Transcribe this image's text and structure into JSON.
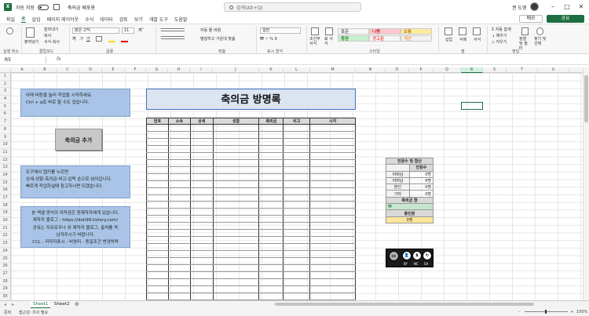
{
  "titlebar": {
    "autosave_label": "자동 저장",
    "autosave_state": "끔",
    "document_title": "축의금 배포용",
    "search_placeholder": "검색(Alt+Q)",
    "user_name": "권 도영"
  },
  "menu": {
    "tabs": [
      "파일",
      "홈",
      "삽입",
      "페이지 레이아웃",
      "수식",
      "데이터",
      "검토",
      "보기",
      "개발 도구",
      "도움말"
    ],
    "active_tab": "홈",
    "comment_label": "메모",
    "share_label": "공유"
  },
  "ribbon": {
    "groups": [
      "실행 취소",
      "클립보드",
      "글꼴",
      "맞춤",
      "표시 형식",
      "스타일",
      "셀",
      "편집"
    ],
    "paste_label": "붙여넣기",
    "cut_label": "잘라내기",
    "copy_label": "복사",
    "format_painter_label": "서식 복사",
    "font_name": "맑은 고딕",
    "font_size": "11",
    "wrap_text_label": "자동 줄 바꿈",
    "merge_label": "병합하고 가운데 맞춤",
    "number_format": "일반",
    "cond_format_label": "조건부 서식",
    "table_format_label": "표 서식",
    "styles": [
      {
        "name": "표준",
        "bg": "#ffffff",
        "color": "#222222"
      },
      {
        "name": "나쁨",
        "bg": "#ffc7ce",
        "color": "#9c0006"
      },
      {
        "name": "보통",
        "bg": "#ffeb9c",
        "color": "#9c5700"
      },
      {
        "name": "좋음",
        "bg": "#c6efce",
        "color": "#006100"
      },
      {
        "name": "경고문",
        "bg": "#ffffff",
        "color": "#ff0000"
      },
      {
        "name": "계산",
        "bg": "#f2f2f2",
        "color": "#fa7d00"
      }
    ],
    "insert_label": "삽입",
    "delete_label": "삭제",
    "format_label": "서식",
    "autosum_label": "자동 합계",
    "fill_label": "채우기",
    "clear_label": "지우기",
    "sort_label": "정렬 및 필터",
    "find_label": "찾기 및 선택"
  },
  "formula": {
    "name_box": "R5",
    "fx": "fx"
  },
  "columns": [
    "A",
    "B",
    "C",
    "D",
    "E",
    "F",
    "G",
    "H",
    "I",
    "J",
    "K",
    "L",
    "M",
    "N",
    "O",
    "P",
    "Q",
    "R",
    "S",
    "T",
    "U"
  ],
  "selected_column": "R",
  "rows": [
    "1",
    "2",
    "3",
    "4",
    "5",
    "6",
    "7",
    "8",
    "9",
    "10",
    "11",
    "12",
    "13",
    "14",
    "15",
    "16",
    "17",
    "18",
    "19",
    "20",
    "21",
    "22",
    "23",
    "24",
    "25",
    "26",
    "27",
    "28",
    "29",
    "30"
  ],
  "sheet": {
    "callout1": [
      "아래 버튼을 눌러 작업을 시작하세요.",
      "Ctrl + q로 바로 할 수도 있습니다."
    ],
    "add_button": "축의금 추가",
    "callout2": [
      "도구에서 탭키를 누르면",
      "상세-성함-축의금-비고-입력 순으로 넘어갑니다.",
      "빠르게 작업하실때 참고하시면 되겠습니다."
    ],
    "callout3": [
      "본 엑셀 양식의 저작권은 원제작자에게 있습니다.",
      "제작자 블로그 : https://doh99.tistory.com/",
      "공유는 자유로우나 위 제작자 블로그, 출처를 꼭",
      "남겨주시기 바랍니다.",
      "CCL : 저작자표시 - 비영리 - 동일조건 변경허락"
    ],
    "banner_title": "축의금 방명록",
    "table_headers": [
      "번호",
      "소속",
      "상세",
      "성함",
      "축의금",
      "비고",
      "시각"
    ],
    "summary": {
      "title": "인원수 및 합산",
      "count_header": "인원수",
      "rows": [
        {
          "label": "아버님",
          "value": "0명"
        },
        {
          "label": "어머님",
          "value": "0명"
        },
        {
          "label": "본인",
          "value": "0명"
        },
        {
          "label": "기타",
          "value": "0명"
        }
      ],
      "total_label": "축의금 합",
      "total_currency": "₩",
      "total_value": "-",
      "headcount_label": "총인원",
      "headcount_value": "0명"
    },
    "cc_labels": [
      "BY",
      "NC",
      "SA"
    ],
    "cc_mark": "cc"
  },
  "sheet_tabs": [
    "Sheet1",
    "Sheet2"
  ],
  "active_sheet": "Sheet1",
  "status": {
    "ready": "준비",
    "accessibility": "접근성: 조사 필요",
    "zoom": "100%"
  }
}
